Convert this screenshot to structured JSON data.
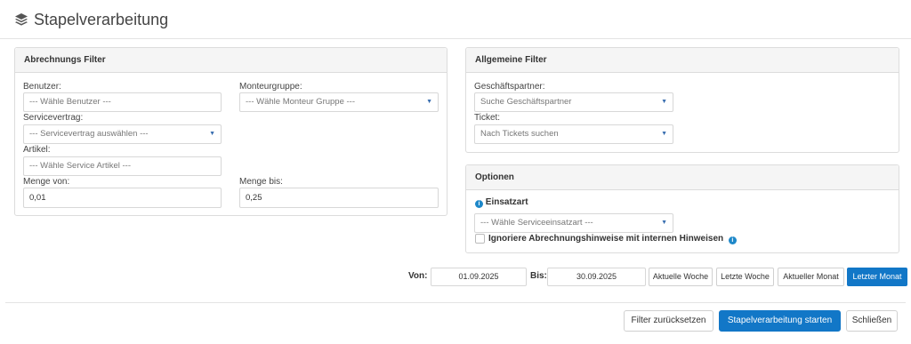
{
  "page": {
    "title": "Stapelverarbeitung"
  },
  "billing_filter": {
    "heading": "Abrechnungs Filter",
    "user_label": "Benutzer:",
    "user_placeholder": "--- Wähle Benutzer ---",
    "group_label": "Monteurgruppe:",
    "group_placeholder": "--- Wähle Monteur Gruppe ---",
    "contract_label": "Servicevertrag:",
    "contract_placeholder": "--- Servicevertrag auswählen ---",
    "article_label": "Artikel:",
    "article_placeholder": "--- Wähle Service Artikel ---",
    "qty_from_label": "Menge von:",
    "qty_from_value": "0,01",
    "qty_to_label": "Menge bis:",
    "qty_to_value": "0,25"
  },
  "general_filter": {
    "heading": "Allgemeine Filter",
    "partner_label": "Geschäftspartner:",
    "partner_placeholder": "Suche Geschäftspartner",
    "ticket_label": "Ticket:",
    "ticket_placeholder": "Nach Tickets suchen"
  },
  "options": {
    "heading": "Optionen",
    "deployment_label": "Einsatzart",
    "deployment_placeholder": "--- Wähle Serviceeinsatzart ---",
    "ignore_label": "Ignoriere Abrechnungshinweise mit internen Hinweisen",
    "ignore_checked": false
  },
  "date_range": {
    "from_label": "Von:",
    "from_value": "01.09.2025",
    "to_label": "Bis:",
    "to_value": "30.09.2025",
    "presets": [
      "Aktuelle Woche",
      "Letzte Woche",
      "Aktueller Monat",
      "Letzter Monat"
    ],
    "active_preset": "Letzter Monat"
  },
  "footer": {
    "reset_label": "Filter zurücksetzen",
    "start_label": "Stapelverarbeitung starten",
    "close_label": "Schließen"
  },
  "colors": {
    "primary": "#1277c7",
    "info": "#1e88c9"
  }
}
